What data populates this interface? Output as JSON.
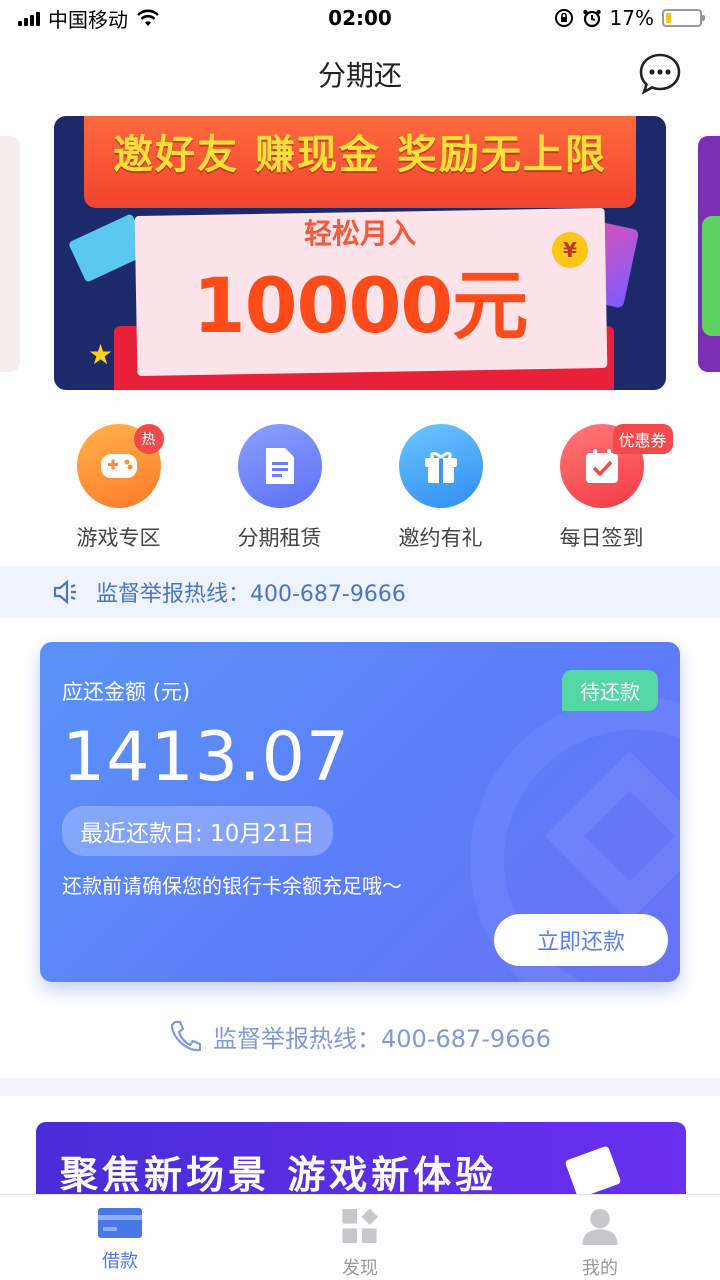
{
  "status_bar": {
    "carrier": "中国移动",
    "time": "02:00",
    "battery": "17%",
    "battery_level": 0.17
  },
  "nav": {
    "title": "分期还",
    "chat_icon": "chat-bubble-icon"
  },
  "banner": {
    "headline": "邀好友 赚现金 奖励无上限",
    "subline": "轻松月入",
    "amount": "10000元",
    "coin": "¥"
  },
  "quick_menu": [
    {
      "label": "游戏专区",
      "icon": "gamepad-icon",
      "badge": "热",
      "color_from": "#ffb24a",
      "color_to": "#ff7a2a"
    },
    {
      "label": "分期租赁",
      "icon": "document-icon",
      "badge": "",
      "color_from": "#8aa2ff",
      "color_to": "#5b6ff5"
    },
    {
      "label": "邀约有礼",
      "icon": "gift-icon",
      "badge": "",
      "color_from": "#6ec6ff",
      "color_to": "#2f8df0"
    },
    {
      "label": "每日签到",
      "icon": "calendar-check-icon",
      "badge": "优惠券",
      "color_from": "#ff7a7a",
      "color_to": "#f23a44"
    }
  ],
  "notice": {
    "text": "监督举报热线：400-687-9666"
  },
  "repay_card": {
    "amount_label": "应还金额 (元)",
    "status": "待还款",
    "amount": "1413.07",
    "due_date": "最近还款日: 10月21日",
    "tip": "还款前请确保您的银行卡余额充足哦～",
    "button": "立即还款"
  },
  "hotline": {
    "text": "监督举报热线：400-687-9666"
  },
  "promo": {
    "text": "聚焦新场景 游戏新体验"
  },
  "tabs": [
    {
      "label": "借款",
      "icon": "card-icon",
      "active": true
    },
    {
      "label": "发现",
      "icon": "discover-icon",
      "active": false
    },
    {
      "label": "我的",
      "icon": "user-icon",
      "active": false
    }
  ],
  "colors": {
    "accent": "#4a78e8",
    "card_gradient": "#5a93f7",
    "badge_green": "#55d6a5",
    "hot_red": "#f24a48"
  }
}
